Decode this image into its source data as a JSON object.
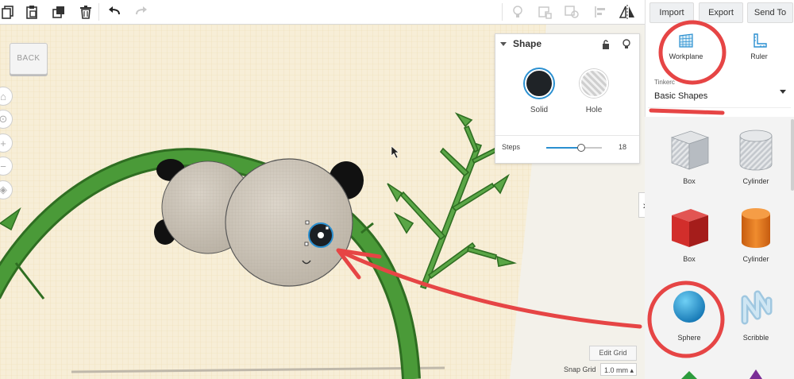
{
  "toolbar": {
    "left_tools": [
      {
        "icon": "copy-icon"
      },
      {
        "icon": "paste-icon"
      },
      {
        "icon": "duplicate-icon"
      },
      {
        "icon": "delete-icon"
      },
      {
        "icon": "undo-icon"
      },
      {
        "icon": "redo-icon"
      }
    ],
    "right_tools": [
      {
        "icon": "light-icon"
      },
      {
        "icon": "group-icon"
      },
      {
        "icon": "ungroup-icon"
      },
      {
        "icon": "align-icon"
      },
      {
        "icon": "mirror-icon"
      }
    ]
  },
  "header_actions": {
    "import_label": "Import",
    "export_label": "Export",
    "send_to_label": "Send To"
  },
  "view_cube": {
    "label": "BACK"
  },
  "nav_controls": [
    {
      "icon": "home-icon"
    },
    {
      "icon": "fit-view-icon"
    },
    {
      "icon": "zoom-in-icon"
    },
    {
      "icon": "zoom-out-icon"
    },
    {
      "icon": "ortho-view-icon"
    }
  ],
  "shape_panel": {
    "title": "Shape",
    "solid_label": "Solid",
    "hole_label": "Hole",
    "steps_label": "Steps",
    "steps_value": "18",
    "steps_fraction": 0.62
  },
  "grid_controls": {
    "edit_grid_label": "Edit Grid",
    "snap_grid_label": "Snap Grid",
    "snap_grid_value": "1.0 mm ▴"
  },
  "sidebar": {
    "workplane_label": "Workplane",
    "ruler_label": "Ruler",
    "library_small_label": "Tinkerc",
    "library_value": "Basic Shapes",
    "shapes": [
      {
        "label": "Box",
        "icon": "box-striped-icon"
      },
      {
        "label": "Cylinder",
        "icon": "cylinder-striped-icon"
      },
      {
        "label": "Box",
        "icon": "box-red-icon"
      },
      {
        "label": "Cylinder",
        "icon": "cylinder-orange-icon"
      },
      {
        "label": "Sphere",
        "icon": "sphere-blue-icon"
      },
      {
        "label": "Scribble",
        "icon": "scribble-icon"
      }
    ]
  },
  "colors": {
    "annotation_red": "#e64545",
    "selection_blue": "#2a8fd0",
    "workplane": "#f7eed7",
    "bamboo_green": "#3f8c2f"
  }
}
